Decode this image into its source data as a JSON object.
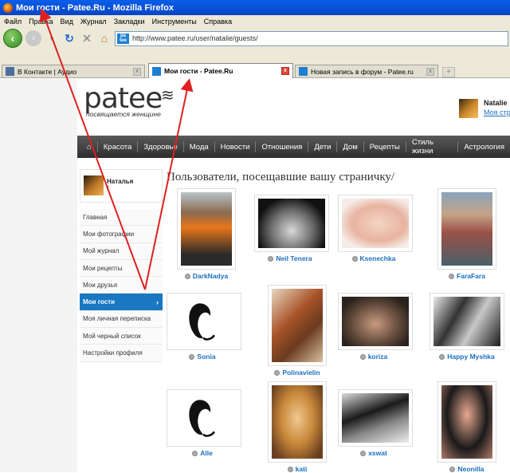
{
  "window": {
    "title": "Мои гости - Patee.Ru - Mozilla Firefox"
  },
  "menubar": [
    "Файл",
    "Правка",
    "Вид",
    "Журнал",
    "Закладки",
    "Инструменты",
    "Справка"
  ],
  "address": {
    "url": "http://www.patee.ru/user/natalie/guests/",
    "favicon_text": "pa tee"
  },
  "tabs": [
    {
      "title": "В Контакте | Аудио",
      "active": false
    },
    {
      "title": "Мои гости - Patee.Ru",
      "active": true
    },
    {
      "title": "Новая запись в форум - Patee.ru",
      "active": false
    }
  ],
  "site": {
    "logo": "patee",
    "tagline": "посвящается женщине",
    "user": {
      "name": "Natalie",
      "link": "Моя стра"
    },
    "nav": [
      "Красота",
      "Здоровье",
      "Мода",
      "Новости",
      "Отношения",
      "Дети",
      "Дом",
      "Рецепты",
      "Стиль жизни",
      "Астрология"
    ]
  },
  "sidebar": {
    "profile_name": "Наталья",
    "profile_extra": "!",
    "items": [
      {
        "label": "Главная"
      },
      {
        "label": "Мои фотографии"
      },
      {
        "label": "Мой журнал"
      },
      {
        "label": "Мои рецепты"
      },
      {
        "label": "Мои друзья"
      },
      {
        "label": "Мои гости",
        "active": true,
        "arrow": "›"
      },
      {
        "label": "Моя личная переписка"
      },
      {
        "label": "Мой черный список"
      },
      {
        "label": "Настройки профиля"
      }
    ]
  },
  "main": {
    "heading": "Пользователи, посещавшие вашу страничку/",
    "guests": [
      "DarkNadya",
      "Neil Tenera",
      "Ksenechka",
      "FaraFara",
      "Sonia",
      "Polinavielin",
      "koriza",
      "Happy Myshka",
      "Alle",
      "kati",
      "xswat",
      "Neonilla"
    ]
  },
  "colors": {
    "accent": "#1a78c2",
    "link": "#1a6fc0",
    "nav_bg": "#3a3a3a",
    "annotation": "#e02020"
  }
}
